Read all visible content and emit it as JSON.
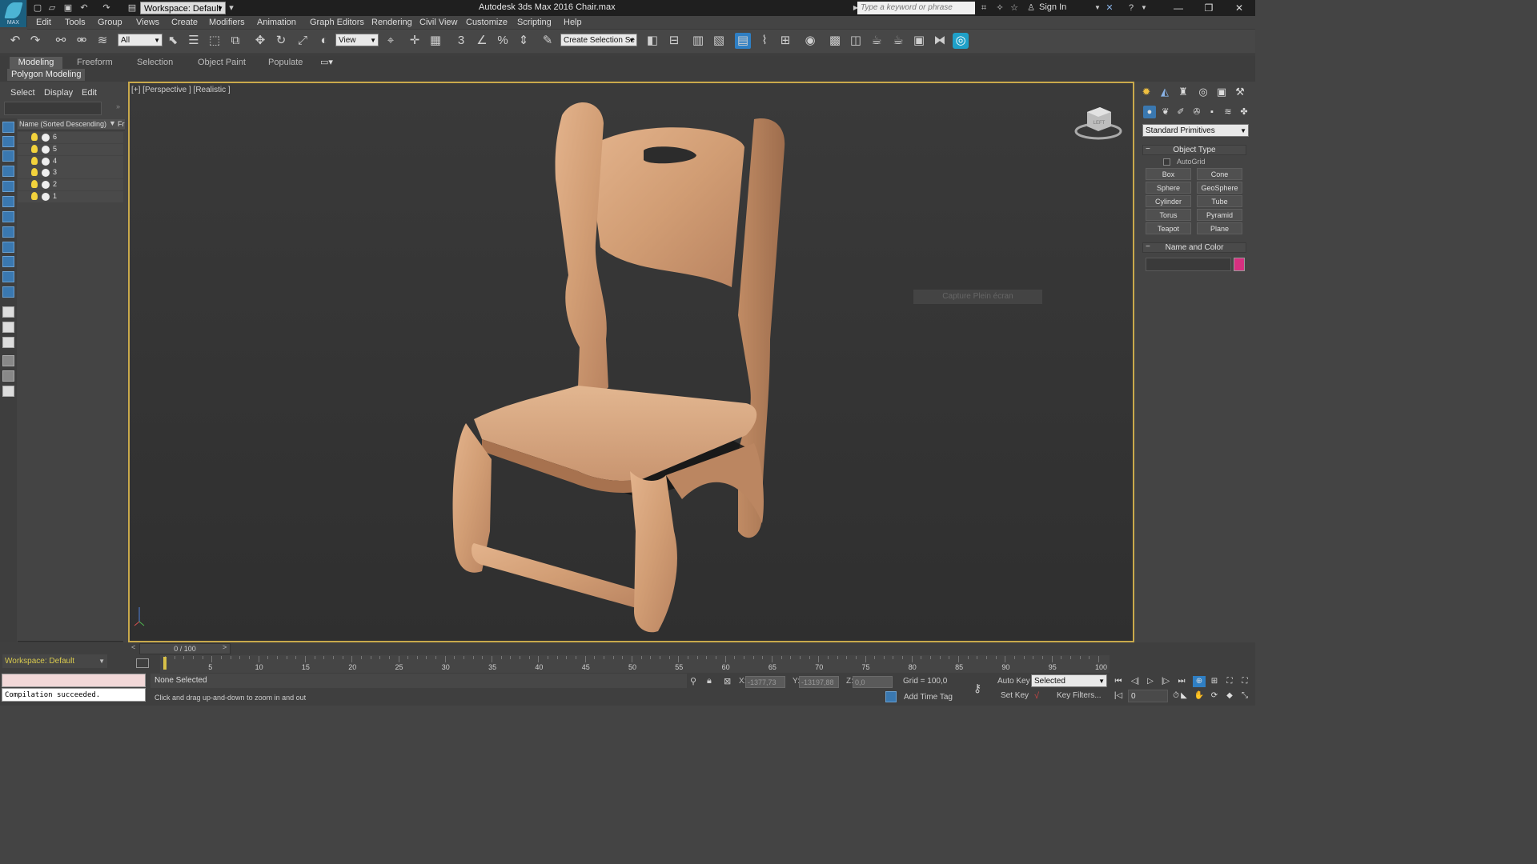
{
  "app": {
    "logo_text": "MAX",
    "window_title": "Autodesk 3ds Max 2016      Chair.max",
    "workspace": "Workspace: Default",
    "search_placeholder": "Type a keyword or phrase",
    "sign_in": "Sign In"
  },
  "menu": [
    "Edit",
    "Tools",
    "Group",
    "Views",
    "Create",
    "Modifiers",
    "Animation",
    "Graph Editors",
    "Rendering",
    "Civil View",
    "Customize",
    "Scripting",
    "Help"
  ],
  "toolbar": {
    "selection_filter": "All",
    "reference_coord": "View",
    "named_selection": "Create Selection Se",
    "snap_label": "3"
  },
  "ribbon": {
    "tabs": [
      "Modeling",
      "Freeform",
      "Selection",
      "Object Paint",
      "Populate"
    ],
    "panel": "Polygon Modeling"
  },
  "explorer": {
    "menu": [
      "Select",
      "Display",
      "Edit"
    ],
    "column_name": "Name (Sorted Descending)",
    "column_fr": "Fr",
    "objects": [
      "6",
      "5",
      "4",
      "3",
      "2",
      "1"
    ]
  },
  "viewport": {
    "label": "[+] [Perspective ] [Realistic ]",
    "capture_button": "Capture Plein écran",
    "cube_label": "LEFT"
  },
  "command_panel": {
    "category": "Standard Primitives",
    "object_type_title": "Object Type",
    "autogrid": "AutoGrid",
    "primitives": [
      "Box",
      "Cone",
      "Sphere",
      "GeoSphere",
      "Cylinder",
      "Tube",
      "Torus",
      "Pyramid",
      "Teapot",
      "Plane"
    ],
    "name_color_title": "Name and Color",
    "object_color": "#d63080"
  },
  "timeline": {
    "slider": "0 / 100",
    "ticks": [
      "5",
      "10",
      "15",
      "20",
      "25",
      "30",
      "35",
      "40",
      "45",
      "50",
      "55",
      "60",
      "65",
      "70",
      "75",
      "80",
      "85",
      "90",
      "95",
      "100"
    ]
  },
  "status": {
    "workspace": "Workspace: Default",
    "compile_msg": "Compilation succeeded.",
    "selection": "None Selected",
    "prompt": "Click and drag up-and-down to zoom in and out",
    "x_label": "X:",
    "x_value": "-1377,73",
    "y_label": "Y:",
    "y_value": "-13197,88",
    "z_label": "Z:",
    "z_value": "0,0",
    "grid": "Grid = 100,0",
    "add_time_tag": "Add Time Tag",
    "auto_key": "Auto Key",
    "set_key": "Set Key",
    "key_mode": "Selected",
    "key_filters": "Key Filters...",
    "frame": "0"
  }
}
